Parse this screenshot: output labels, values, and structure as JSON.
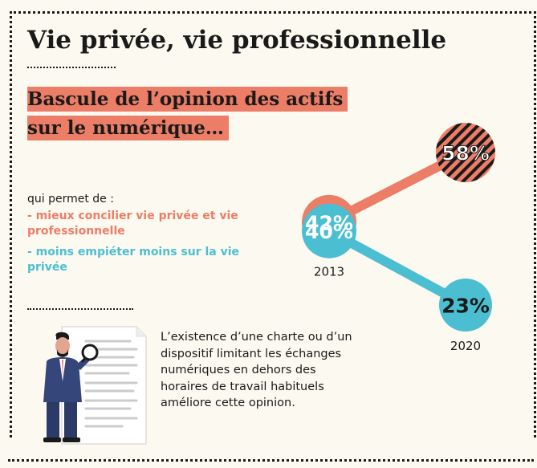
{
  "title": "Vie privée, vie professionnelle",
  "subtitle_line1": "Bascule de l’opinion des actifs",
  "subtitle_line2": "sur le numérique…",
  "intro": "qui permet de :",
  "legend_orange": "- mieux concilier vie privée et vie professionnelle",
  "legend_blue": "- moins empiéter moins sur la vie privée",
  "note": "L’existence d’une charte ou d’un dispositif limitant les échanges numériques en dehors des horaires de travail habituels améliore cette opinion.",
  "colors": {
    "orange": "#ec7d67",
    "blue": "#4bbfd1",
    "dark": "#1a1a1a",
    "background": "#fcf9f0"
  },
  "chart_data": {
    "type": "line",
    "categories": [
      "2013",
      "2020"
    ],
    "series": [
      {
        "values": [
          42,
          58
        ],
        "labels": [
          "42%",
          "58%"
        ],
        "color": "#ec7d67"
      },
      {
        "values": [
          40,
          23
        ],
        "labels": [
          "40%",
          "23%"
        ],
        "color": "#4bbfd1"
      }
    ],
    "grid": false,
    "axes_visible": false
  },
  "illustration": {
    "icon": "person-with-magnifier-and-document"
  }
}
